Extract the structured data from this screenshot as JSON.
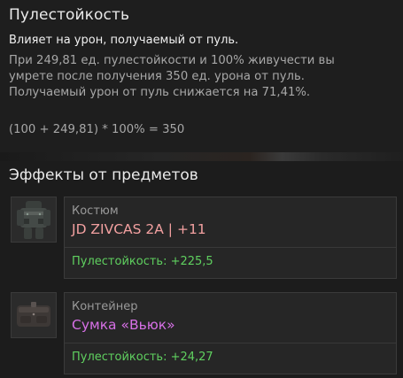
{
  "tooltip": {
    "title": "Пулестойкость",
    "subtitle": "Влияет на урон, получаемый от пуль.",
    "description_lines": [
      "При 249,81 ед. пулестойкости и 100% живучести вы",
      "умрете после получения 350 ед. урона от пуль.",
      "Получаемый урон от пуль снижается на 71,41%."
    ],
    "formula": "(100 + 249,81) * 100% = 350"
  },
  "effects": {
    "title": "Эффекты от предметов",
    "items": [
      {
        "type": "Костюм",
        "name": "JD ZIVCAS 2A  |  +11",
        "name_color": "#f2a0a0",
        "stat": "Пулестойкость: +225,5",
        "icon": "armor-suit-icon"
      },
      {
        "type": "Контейнер",
        "name": "Сумка «Вьюк»",
        "name_color": "#d770e6",
        "stat": "Пулестойкость: +24,27",
        "icon": "container-bag-icon"
      }
    ]
  },
  "colors": {
    "stat_green": "#5fd05f",
    "background": "#1c1c1c"
  }
}
